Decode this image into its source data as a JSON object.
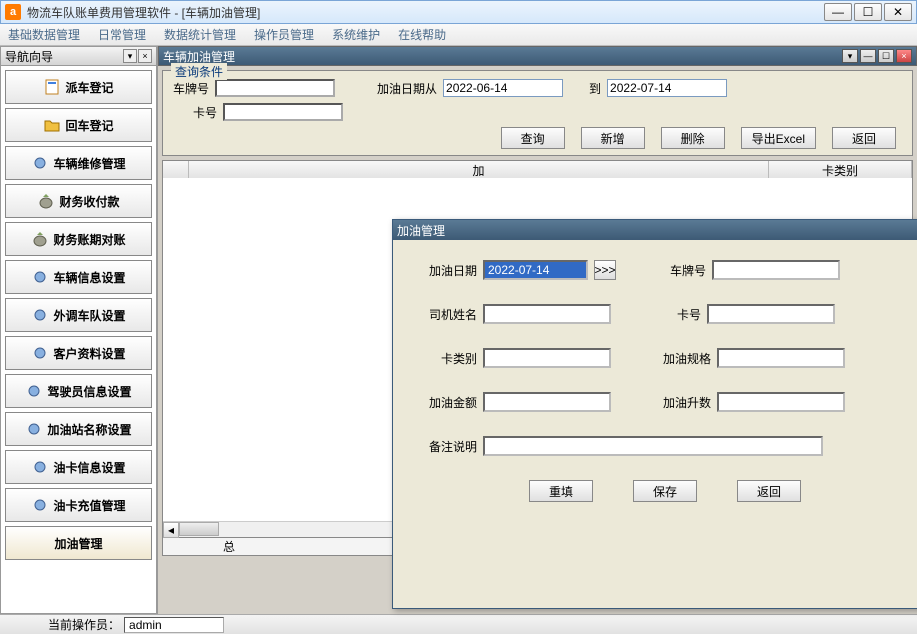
{
  "window": {
    "title": "物流车队账单费用管理软件   - [车辆加油管理]",
    "min": "—",
    "max": "☐",
    "close": "✕"
  },
  "menubar": [
    "基础数据管理",
    "日常管理",
    "数据统计管理",
    "操作员管理",
    "系统维护",
    "在线帮助"
  ],
  "nav": {
    "header": "导航向导",
    "items": [
      "派车登记",
      "回车登记",
      "车辆维修管理",
      "财务收付款",
      "财务账期对账",
      "车辆信息设置",
      "外调车队设置",
      "客户资料设置",
      "驾驶员信息设置",
      "加油站名称设置",
      "油卡信息设置",
      "油卡充值管理",
      "加油管理"
    ]
  },
  "mdi": {
    "title": "车辆加油管理"
  },
  "query": {
    "legend": "查询条件",
    "plate_label": "车牌号",
    "plate_value": "",
    "date_from_label": "加油日期从",
    "date_from": "2022-06-14",
    "date_to_label": "到",
    "date_to": "2022-07-14",
    "card_label": "卡号",
    "card_value": "",
    "btn_query": "查询",
    "btn_add": "新增",
    "btn_del": "删除",
    "btn_export": "导出Excel",
    "btn_back": "返回"
  },
  "grid": {
    "rowhead": "",
    "cols": [
      "加",
      "卡类别"
    ]
  },
  "totals": {
    "label": "总"
  },
  "status": {
    "label": "当前操作员：",
    "value": "admin"
  },
  "modal": {
    "title": "加油管理",
    "date_label": "加油日期",
    "date_value": "2022-07-14",
    "date_spin": ">>>",
    "plate_label": "车牌号",
    "plate_value": "",
    "driver_label": "司机姓名",
    "driver_value": "",
    "card_label": "卡号",
    "card_value": "",
    "cardtype_label": "卡类别",
    "cardtype_value": "",
    "spec_label": "加油规格",
    "spec_value": "",
    "amount_label": "加油金额",
    "amount_value": "",
    "liter_label": "加油升数",
    "liter_value": "",
    "remark_label": "备注说明",
    "remark_value": "",
    "btn_reset": "重填",
    "btn_save": "保存",
    "btn_back": "返回"
  }
}
